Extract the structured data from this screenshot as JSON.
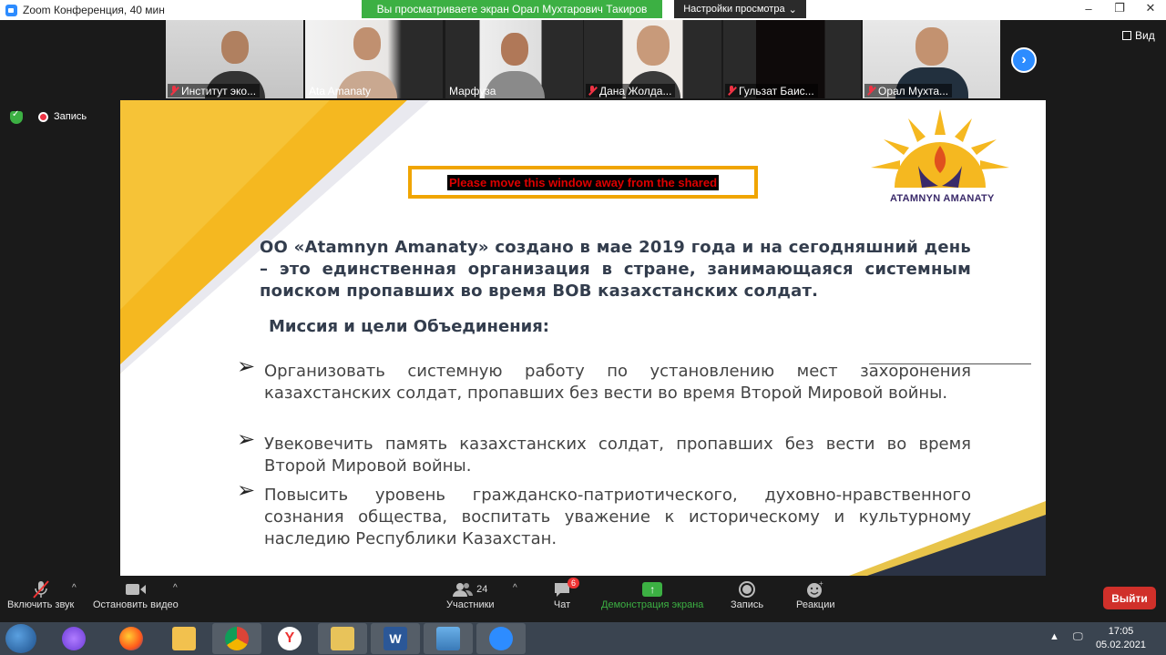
{
  "window": {
    "title": "Zoom Конференция, 40 мин",
    "share_banner": "Вы просматриваете экран Орал Мухтарович Такиров",
    "view_settings": "Настройки просмотра",
    "view_button": "Вид"
  },
  "participants": [
    {
      "name": "Институт эко...",
      "muted": true
    },
    {
      "name": "Ata Amanaty",
      "muted": false
    },
    {
      "name": "Марфуза",
      "muted": false
    },
    {
      "name": "Дана Жолда...",
      "muted": true
    },
    {
      "name": "Гульзат Баис...",
      "muted": true
    },
    {
      "name": "Орал Мухта...",
      "muted": true
    }
  ],
  "status": {
    "recording_label": "Запись"
  },
  "slide": {
    "warning": "Please move this window away from the shared",
    "logo_text": "ATAMNYN AMANATY",
    "intro": "ОО «Atamnyn Amanaty» создано в мае 2019 года и на сегодняшний день – это единственная организация в стране, занимающаяся системным поиском пропавших во время ВОВ казахстанских солдат.",
    "mission_heading": "Миссия и цели Объединения:",
    "bullets": [
      "Организовать системную работу по установлению мест захоронения казахстанских солдат, пропавших без вести во время Второй Мировой войны.",
      "Увековечить память казахстанских солдат, пропавших без вести во время Второй Мировой войны.",
      "Повысить уровень гражданско-патриотического, духовно-нравственного сознания общества, воспитать уважение к историческому и культурному наследию Республики Казахстан."
    ]
  },
  "toolbar": {
    "unmute": "Включить звук",
    "stop_video": "Остановить видео",
    "participants": "Участники",
    "participants_count": "24",
    "chat": "Чат",
    "chat_badge": "6",
    "share_screen": "Демонстрация экрана",
    "record": "Запись",
    "reactions": "Реакции",
    "leave": "Выйти"
  },
  "taskbar": {
    "time": "17:05",
    "date": "05.02.2021"
  },
  "colors": {
    "banner_green": "#3cb043",
    "accent_yellow": "#f5b820",
    "leave_red": "#d0302a",
    "zoom_blue": "#2d8cff"
  }
}
